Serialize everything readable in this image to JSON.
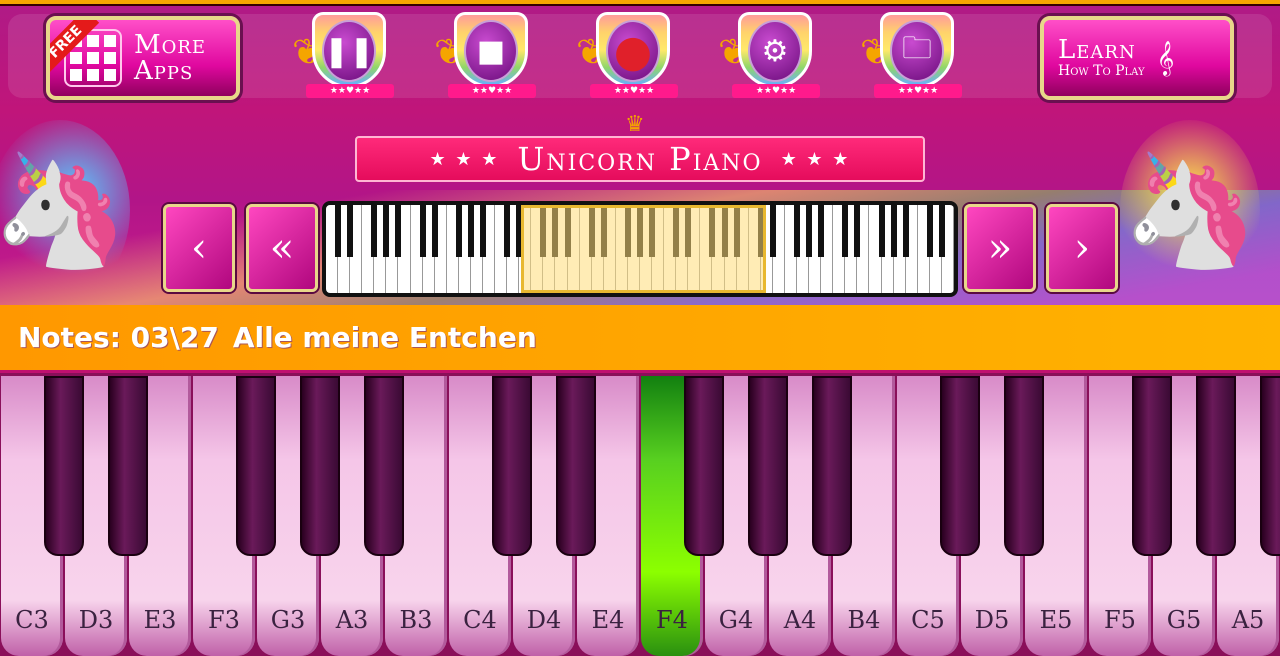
{
  "header": {
    "more_apps": {
      "badge": "FREE",
      "line1": "More",
      "line2": "Apps"
    },
    "controls": [
      {
        "name": "pause",
        "glyph": "❚❚"
      },
      {
        "name": "stop",
        "glyph": "■"
      },
      {
        "name": "record",
        "glyph": "●"
      },
      {
        "name": "settings",
        "glyph": "⚙"
      },
      {
        "name": "open-folder",
        "glyph": "🗀"
      }
    ],
    "learn": {
      "line1": "Learn",
      "line2": "How To Play"
    },
    "ribbon": "★★♥★★"
  },
  "title": {
    "text": "Unicorn Piano",
    "stars": "★ ★ ★"
  },
  "navigator": {
    "prev": "‹",
    "prev_fast": "«",
    "next_fast": "»",
    "next": "›"
  },
  "status": {
    "notes_label": "Notes: 03\\27",
    "song": "Alle meine Entchen"
  },
  "keyboard": {
    "white_keys": [
      "C3",
      "D3",
      "E3",
      "F3",
      "G3",
      "A3",
      "B3",
      "C4",
      "D4",
      "E4",
      "F4",
      "G4",
      "A4",
      "B4",
      "C5",
      "D5",
      "E5",
      "F5",
      "G5",
      "A5"
    ],
    "active_key": "F4"
  },
  "colors": {
    "active_key": "#8cff00",
    "status_bar": "#ffa000",
    "accent": "#e0089f"
  }
}
